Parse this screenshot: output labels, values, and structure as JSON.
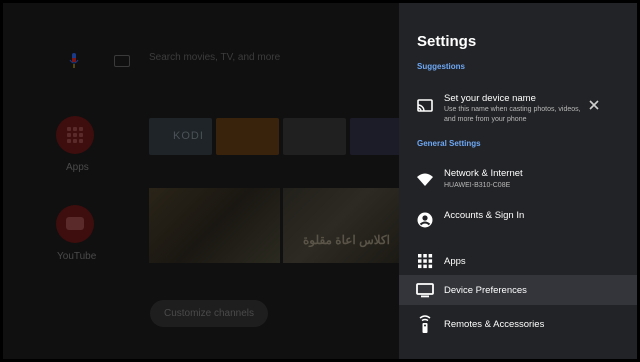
{
  "home": {
    "search_placeholder": "Search movies, TV, and more",
    "apps_label": "Apps",
    "youtube_label": "YouTube",
    "kodi_tile": "KODI",
    "banner_text": "اكلاس اعاة مقلوة",
    "customize_label": "Customize channels"
  },
  "settings": {
    "title": "Settings",
    "suggestions_header": "Suggestions",
    "suggestion": {
      "title": "Set your device name",
      "description": "Use this name when casting photos, videos, and more from your phone"
    },
    "general_header": "General Settings",
    "items": [
      {
        "label": "Network & Internet",
        "sublabel": "HUAWEI-B310-C08E"
      },
      {
        "label": "Accounts & Sign In"
      },
      {
        "label": "Apps"
      },
      {
        "label": "Device Preferences"
      },
      {
        "label": "Remotes & Accessories"
      }
    ]
  },
  "colors": {
    "panel_bg": "#222326",
    "accent_blue": "#6ea8f5",
    "selected_row": "#33353a"
  },
  "icons": [
    "mic-icon",
    "keyboard-icon",
    "apps-grid-icon",
    "youtube-icon",
    "cast-icon",
    "close-icon",
    "wifi-icon",
    "account-icon",
    "apps-icon",
    "tv-icon",
    "remote-icon"
  ]
}
